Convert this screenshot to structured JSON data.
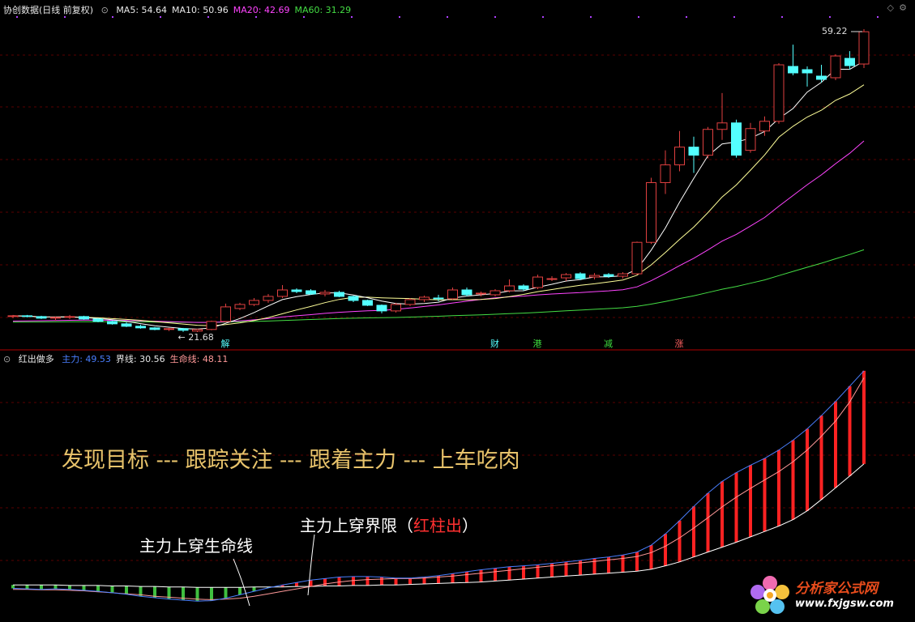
{
  "colors": {
    "background": "#000000",
    "grid": "#5a0000",
    "separator": "#b00000",
    "up": "#e04040",
    "down": "#54ffff",
    "ma5": "#ffffff",
    "ma10": "#ffff99",
    "ma20": "#ff44ff",
    "ma60": "#44dd44",
    "main_force": "#4a7fff",
    "boundary": "#ffffff",
    "lifeline": "#ff9999",
    "red_bar": "#ff2222",
    "green_bar": "#3fbf3f",
    "annotation_yellow": "#e8c36b"
  },
  "top_panel": {
    "title": "协创数据(日线 前复权)",
    "indicators": [
      {
        "key": "ma5",
        "label": "MA5: 54.64",
        "color": "#e8e8e8"
      },
      {
        "key": "ma10",
        "label": "MA10: 50.96",
        "color": "#e8e8e8"
      },
      {
        "key": "ma20",
        "label": "MA20: 42.69",
        "color": "#ff44ff"
      },
      {
        "key": "ma60",
        "label": "MA60: 31.29",
        "color": "#44dd44"
      }
    ],
    "high_label": "59.22",
    "low_label": "21.68",
    "event_markers": [
      {
        "label": "解",
        "color": "#54ffff"
      },
      {
        "label": "财",
        "color": "#54ffff"
      },
      {
        "label": "港",
        "color": "#3fdf3f"
      },
      {
        "label": "减",
        "color": "#3fdf3f"
      },
      {
        "label": "涨",
        "color": "#ff6060"
      }
    ]
  },
  "bottom_panel": {
    "title": "红出做多",
    "indicators": [
      {
        "label": "主力: 49.53",
        "color": "#4a7fff"
      },
      {
        "label": "界线: 30.56",
        "color": "#e8e8e8"
      },
      {
        "label": "生命线: 48.11",
        "color": "#ff9999"
      }
    ],
    "slogan": "发现目标 --- 跟踪关注 --- 跟着主力 --- 上车吃肉",
    "annotation_left": "主力上穿生命线",
    "annotation_right_prefix": "主力上穿界限（",
    "annotation_right_red": "红柱出",
    "annotation_right_suffix": "）"
  },
  "watermark": {
    "site_name": "分析家公式网",
    "url": "www.fxjgsw.com"
  },
  "chart_data": [
    {
      "type": "candlestick",
      "title": "协创数据(日线 前复权)",
      "price_range": [
        21.68,
        59.22
      ],
      "candles": [
        [
          23.6,
          23.8,
          23.4,
          23.7
        ],
        [
          23.7,
          23.8,
          23.5,
          23.6
        ],
        [
          23.6,
          23.7,
          23.3,
          23.4
        ],
        [
          23.4,
          23.6,
          23.1,
          23.5
        ],
        [
          23.5,
          23.8,
          23.3,
          23.6
        ],
        [
          23.6,
          23.7,
          23.2,
          23.3
        ],
        [
          23.3,
          23.4,
          22.9,
          23.0
        ],
        [
          23.0,
          23.1,
          22.6,
          22.7
        ],
        [
          22.7,
          22.9,
          22.3,
          22.4
        ],
        [
          22.4,
          22.6,
          22.1,
          22.2
        ],
        [
          22.2,
          22.3,
          21.9,
          22.0
        ],
        [
          22.0,
          22.2,
          21.8,
          22.1
        ],
        [
          22.1,
          22.2,
          21.7,
          21.9
        ],
        [
          21.8,
          22.1,
          21.68,
          22.0
        ],
        [
          22.0,
          23.1,
          21.9,
          23.0
        ],
        [
          23.0,
          25.2,
          22.9,
          24.8
        ],
        [
          24.6,
          25.3,
          24.4,
          25.1
        ],
        [
          25.1,
          25.9,
          24.9,
          25.6
        ],
        [
          25.6,
          26.4,
          25.3,
          26.1
        ],
        [
          26.1,
          27.5,
          25.9,
          26.9
        ],
        [
          26.9,
          27.1,
          26.5,
          26.7
        ],
        [
          26.8,
          27.0,
          26.3,
          26.4
        ],
        [
          26.4,
          26.9,
          26.1,
          26.6
        ],
        [
          26.6,
          26.8,
          26.0,
          26.1
        ],
        [
          26.1,
          26.2,
          25.4,
          25.6
        ],
        [
          25.6,
          25.7,
          24.9,
          25.0
        ],
        [
          25.0,
          25.1,
          24.0,
          24.3
        ],
        [
          24.3,
          25.3,
          24.1,
          25.1
        ],
        [
          25.1,
          25.9,
          24.9,
          25.7
        ],
        [
          25.7,
          26.2,
          25.4,
          26.0
        ],
        [
          25.9,
          26.3,
          25.5,
          25.8
        ],
        [
          25.8,
          27.2,
          25.7,
          26.9
        ],
        [
          26.9,
          27.2,
          26.1,
          26.3
        ],
        [
          26.4,
          26.7,
          26.1,
          26.5
        ],
        [
          26.3,
          27.0,
          26.1,
          26.8
        ],
        [
          26.8,
          28.2,
          26.6,
          27.4
        ],
        [
          27.4,
          27.6,
          26.8,
          27.0
        ],
        [
          27.2,
          28.8,
          27.0,
          28.5
        ],
        [
          28.3,
          28.6,
          28.0,
          28.3
        ],
        [
          28.4,
          29.0,
          28.0,
          28.8
        ],
        [
          28.9,
          29.1,
          28.1,
          28.3
        ],
        [
          28.5,
          29.0,
          28.2,
          28.7
        ],
        [
          28.8,
          29.0,
          28.4,
          28.6
        ],
        [
          28.6,
          29.1,
          28.3,
          28.9
        ],
        [
          28.9,
          32.9,
          28.8,
          32.8
        ],
        [
          32.8,
          40.8,
          32.6,
          40.2
        ],
        [
          40.2,
          44.2,
          38.8,
          42.4
        ],
        [
          42.4,
          46.6,
          41.6,
          44.6
        ],
        [
          44.6,
          45.9,
          41.4,
          43.6
        ],
        [
          43.6,
          47.1,
          43.2,
          46.8
        ],
        [
          46.8,
          51.3,
          45.5,
          47.6
        ],
        [
          47.6,
          48.0,
          43.3,
          43.6
        ],
        [
          44.2,
          47.6,
          43.9,
          46.9
        ],
        [
          46.6,
          48.4,
          46.0,
          47.8
        ],
        [
          47.8,
          55.0,
          47.5,
          54.8
        ],
        [
          54.6,
          57.3,
          53.5,
          53.8
        ],
        [
          54.2,
          54.6,
          52.1,
          53.8
        ],
        [
          53.4,
          54.8,
          52.6,
          53.0
        ],
        [
          53.2,
          56.1,
          52.9,
          55.9
        ],
        [
          55.6,
          56.5,
          54.2,
          54.7
        ],
        [
          54.9,
          59.22,
          54.4,
          58.9
        ]
      ],
      "ma_final": {
        "MA5": 54.64,
        "MA10": 50.96,
        "MA20": 42.69,
        "MA60": 31.29
      }
    },
    {
      "type": "line",
      "title": "红出做多",
      "series": [
        {
          "name": "主力",
          "last": 49.53
        },
        {
          "name": "界线",
          "last": 30.56
        },
        {
          "name": "生命线",
          "last": 48.11
        }
      ],
      "main_force": [
        5.2,
        5.1,
        5.0,
        5.1,
        5.0,
        4.8,
        4.6,
        4.3,
        4.0,
        3.6,
        3.3,
        3.0,
        2.8,
        2.6,
        2.7,
        3.2,
        3.9,
        4.6,
        5.3,
        5.9,
        6.4,
        6.9,
        7.2,
        7.5,
        7.6,
        7.6,
        7.5,
        7.3,
        7.3,
        7.5,
        7.8,
        8.2,
        8.6,
        9.0,
        9.3,
        9.6,
        9.8,
        10.0,
        10.3,
        10.6,
        10.9,
        11.3,
        11.6,
        12.0,
        12.6,
        14.0,
        16.3,
        19.0,
        21.9,
        24.6,
        27.0,
        28.8,
        30.3,
        31.7,
        33.4,
        35.4,
        37.7,
        40.4,
        43.3,
        46.4,
        49.53
      ],
      "lifeline": [
        5.0,
        5.0,
        4.9,
        4.9,
        4.8,
        4.7,
        4.5,
        4.3,
        4.1,
        3.9,
        3.6,
        3.4,
        3.2,
        3.0,
        2.9,
        3.0,
        3.2,
        3.6,
        4.1,
        4.6,
        5.1,
        5.6,
        6.1,
        6.5,
        6.8,
        7.0,
        7.1,
        7.2,
        7.2,
        7.3,
        7.5,
        7.7,
        8.0,
        8.3,
        8.6,
        8.9,
        9.2,
        9.5,
        9.8,
        10.1,
        10.4,
        10.7,
        11.0,
        11.3,
        11.7,
        12.5,
        13.8,
        15.5,
        17.5,
        19.6,
        21.8,
        23.8,
        25.6,
        27.3,
        29.0,
        31.0,
        33.4,
        36.2,
        39.3,
        43.2,
        48.11
      ],
      "boundary": [
        5.9,
        5.9,
        5.9,
        5.9,
        5.8,
        5.8,
        5.8,
        5.7,
        5.7,
        5.6,
        5.6,
        5.5,
        5.5,
        5.4,
        5.4,
        5.4,
        5.4,
        5.5,
        5.5,
        5.5,
        5.6,
        5.6,
        5.7,
        5.7,
        5.8,
        5.8,
        5.9,
        5.9,
        6.0,
        6.1,
        6.2,
        6.3,
        6.4,
        6.5,
        6.7,
        6.9,
        7.1,
        7.3,
        7.5,
        7.7,
        7.9,
        8.1,
        8.3,
        8.5,
        8.7,
        9.1,
        9.8,
        10.6,
        11.6,
        12.6,
        13.6,
        14.6,
        15.7,
        16.8,
        17.9,
        19.2,
        21.0,
        23.3,
        25.7,
        28.1,
        30.56
      ]
    }
  ]
}
